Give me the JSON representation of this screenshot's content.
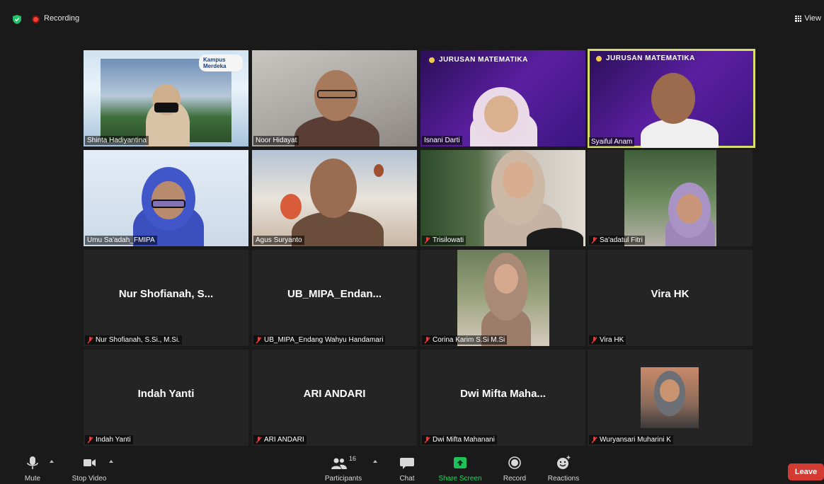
{
  "topbar": {
    "recording_label": "Recording",
    "view_label": "View"
  },
  "participants": [
    {
      "name": "Shinta Hadiyantina",
      "muted": false,
      "video": true
    },
    {
      "name": "Noor Hidayat",
      "muted": false,
      "video": true
    },
    {
      "name": "Isnani Darti",
      "muted": false,
      "video": true,
      "banner": "JURUSAN MATEMATIKA"
    },
    {
      "name": "Syaiful Anam",
      "muted": false,
      "video": true,
      "banner": "JURUSAN MATEMATIKA",
      "active_speaker": true
    },
    {
      "name": "Umu Sa'adah_FMIPA",
      "muted": false,
      "video": true
    },
    {
      "name": "Agus Suryanto",
      "muted": false,
      "video": true
    },
    {
      "name": "Trisilowati",
      "muted": true,
      "video": true
    },
    {
      "name": "Sa'adatul Fitri",
      "muted": true,
      "video": true
    },
    {
      "name": "Nur Shofianah, S.Si., M.Si.",
      "display": "Nur Shofianah, S...",
      "muted": true,
      "video": false
    },
    {
      "name": "UB_MIPA_Endang Wahyu Handamari",
      "display": "UB_MIPA_Endan...",
      "muted": true,
      "video": false
    },
    {
      "name": "Corina Karim S.Si M.Si",
      "muted": true,
      "video": true
    },
    {
      "name": "Vira HK",
      "display": "Vira HK",
      "muted": true,
      "video": false
    },
    {
      "name": "Indah Yanti",
      "display": "Indah Yanti",
      "muted": true,
      "video": false
    },
    {
      "name": "ARI ANDARI",
      "display": "ARI ANDARI",
      "muted": true,
      "video": false
    },
    {
      "name": "Dwi Mifta Mahanani",
      "display": "Dwi Mifta Maha...",
      "muted": true,
      "video": false
    },
    {
      "name": "Wuryansari Muharini K",
      "muted": true,
      "video": true
    }
  ],
  "kampus_logo": "Kampus Merdeka",
  "toolbar": {
    "mute_label": "Mute",
    "stop_video_label": "Stop Video",
    "participants_label": "Participants",
    "participants_count": "16",
    "chat_label": "Chat",
    "share_screen_label": "Share Screen",
    "record_label": "Record",
    "reactions_label": "Reactions",
    "leave_label": "Leave"
  },
  "colors": {
    "accent_share": "#20d860",
    "leave": "#d23a32",
    "active_speaker": "#d8de6a",
    "muted_icon": "#e04040"
  }
}
